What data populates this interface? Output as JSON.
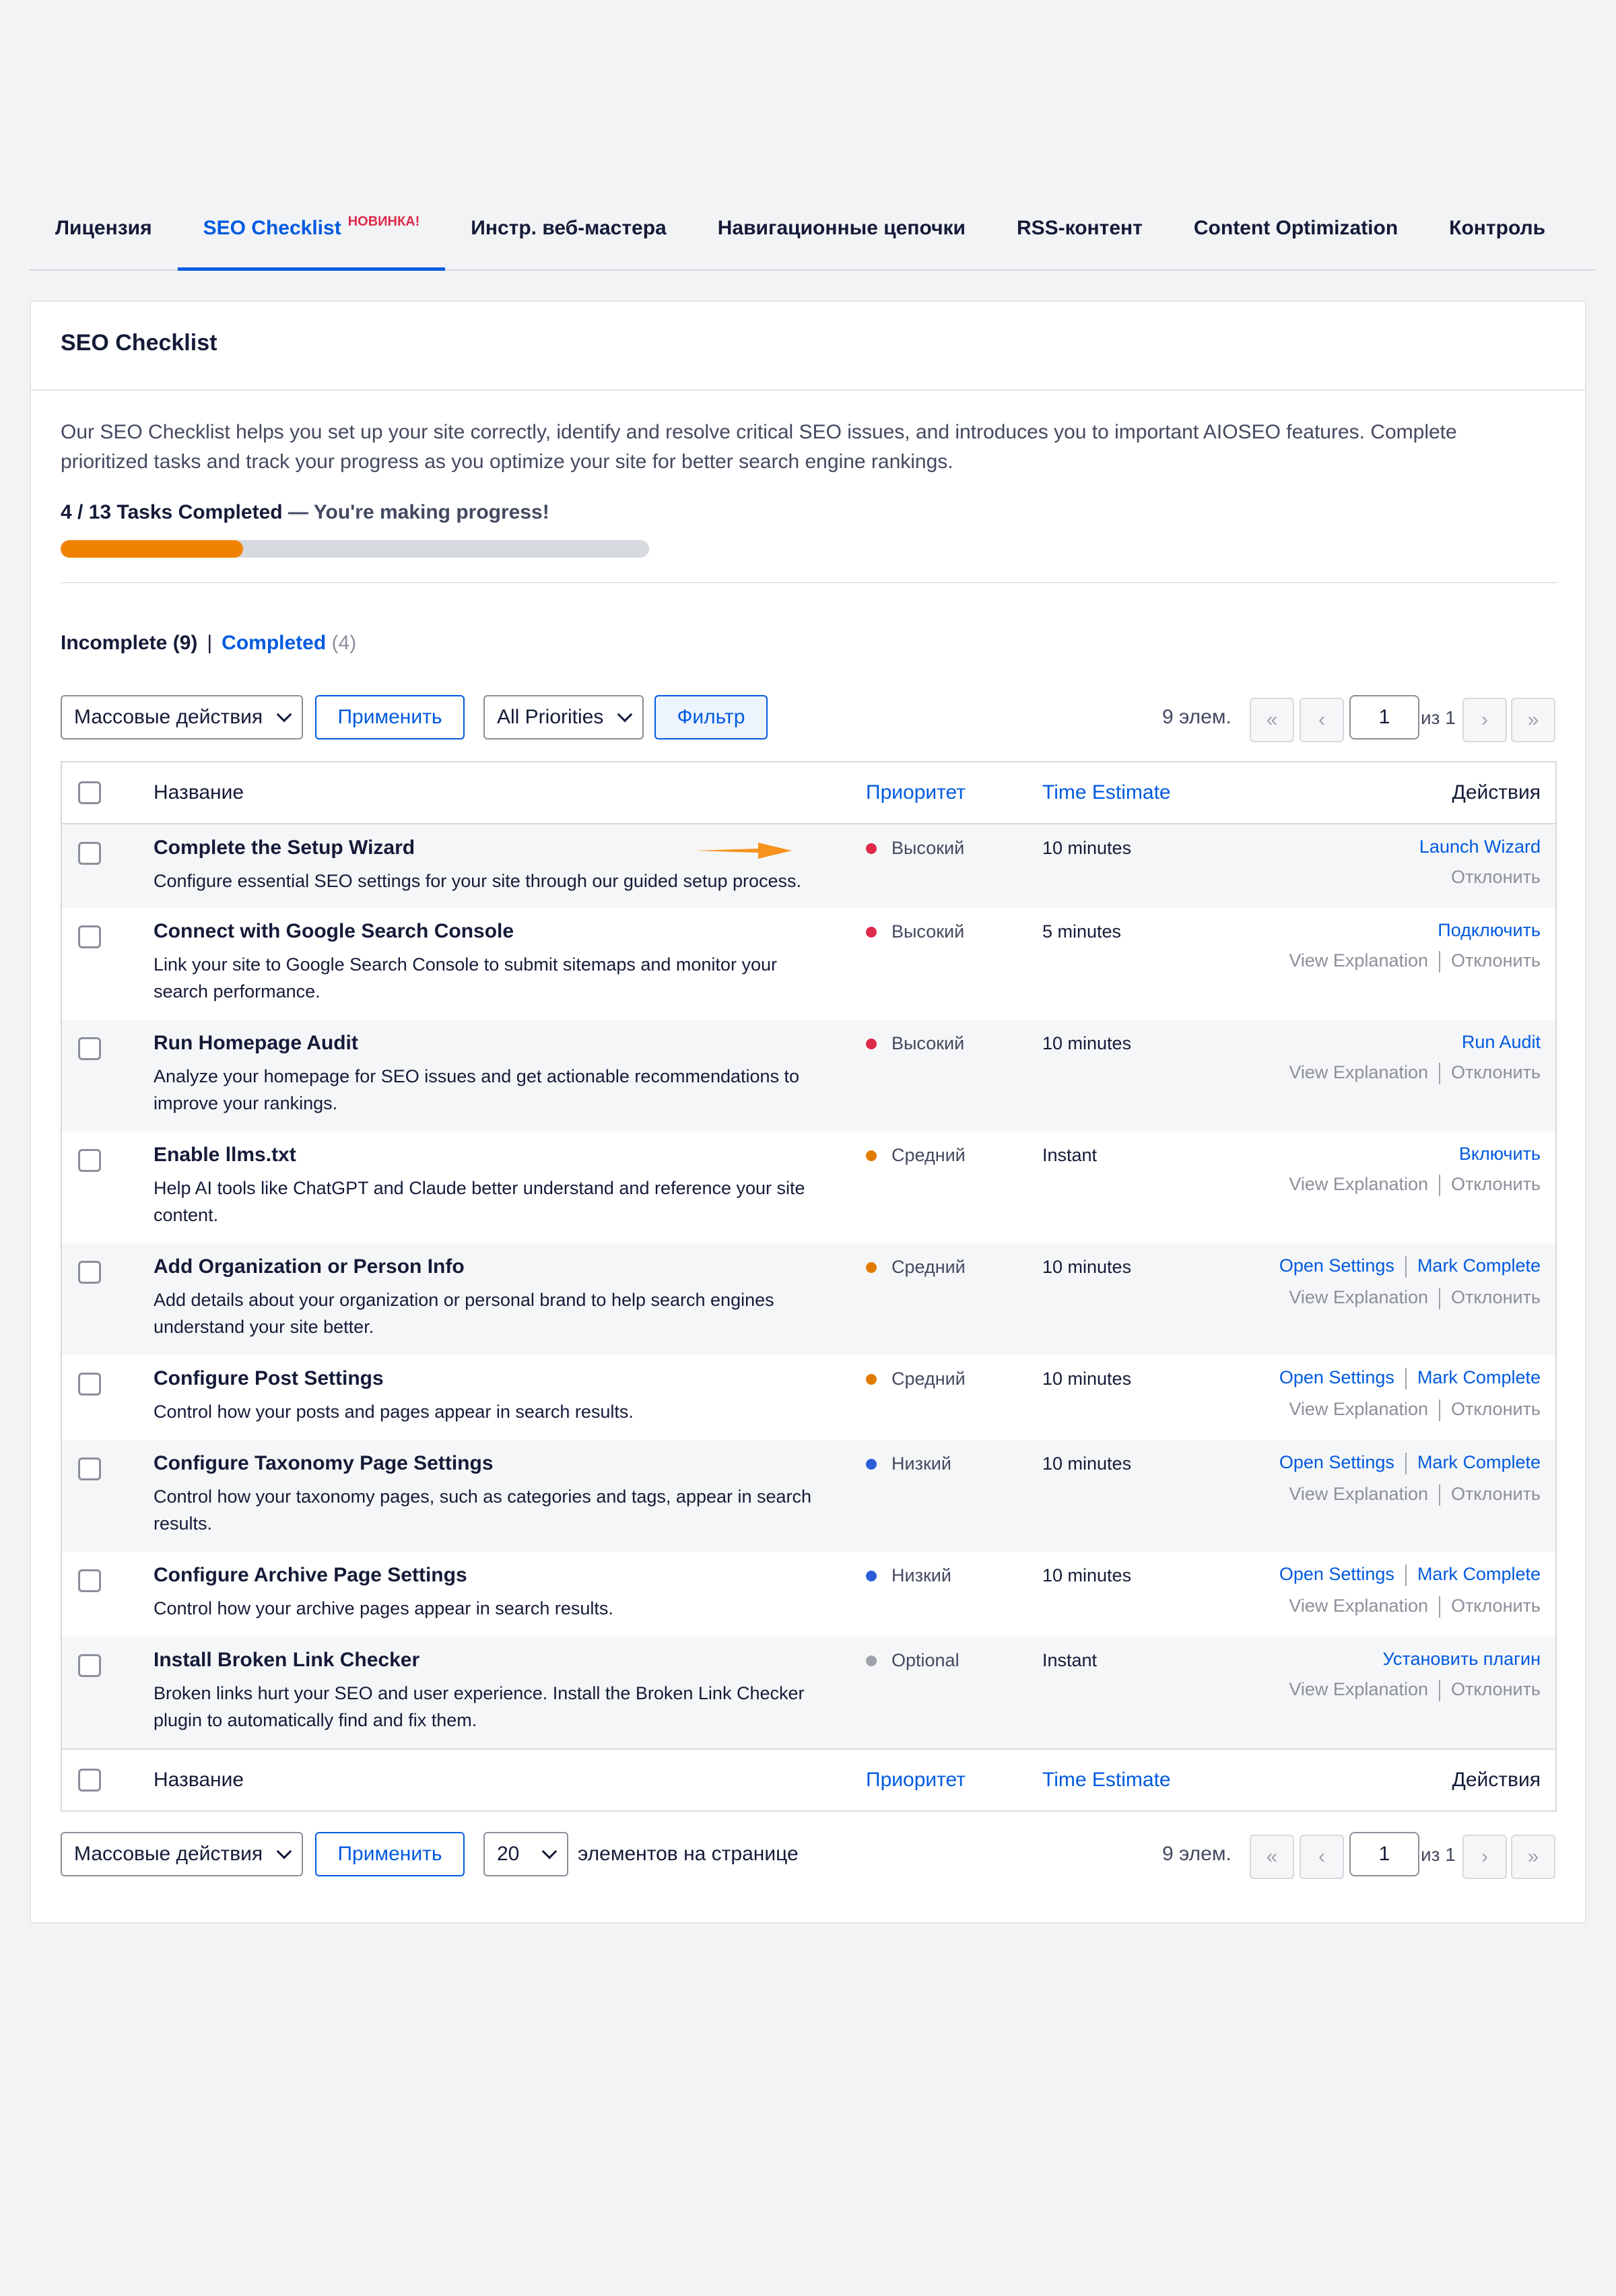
{
  "tabs": [
    {
      "label": "Лицензия",
      "active": false
    },
    {
      "label": "SEO Checklist",
      "badge": "НОВИНКА!",
      "active": true
    },
    {
      "label": "Инстр. веб-мастера",
      "active": false
    },
    {
      "label": "Навигационные цепочки",
      "active": false
    },
    {
      "label": "RSS-контент",
      "active": false
    },
    {
      "label": "Content Optimization",
      "active": false
    },
    {
      "label": "Контроль",
      "active": false
    }
  ],
  "card": {
    "title": "SEO Checklist",
    "intro": "Our SEO Checklist helps you set up your site correctly, identify and resolve critical SEO issues, and introduces you to important AIOSEO features. Complete prioritized tasks and track your progress as you optimize your site for better search engine rankings.",
    "progress_label": "4 / 13 Tasks Completed",
    "progress_message": " — You're making progress!",
    "progress_fraction": 0.31,
    "progress_color": "#f18200"
  },
  "filters": {
    "incomplete": "Incomplete (9)",
    "separator": "|",
    "completed": "Completed",
    "completed_count": "(4)"
  },
  "toolbar": {
    "bulk_actions": "Массовые действия",
    "apply": "Применить",
    "priorities": "All Priorities",
    "filter": "Фильтр",
    "items_count": "9 элем.",
    "first": "«",
    "prev": "‹",
    "page": "1",
    "of_pages": "из 1",
    "next": "›",
    "last": "»",
    "per_page_value": "20",
    "per_page_label": "элементов на странице"
  },
  "table": {
    "headers": {
      "name": "Название",
      "priority": "Приоритет",
      "time": "Time Estimate",
      "actions": "Действия"
    },
    "secondary_view": "View Explanation",
    "secondary_dismiss": "Отклонить",
    "priority_colors": {
      "Высокий": "#df2a4a",
      "Средний": "#e07b00",
      "Низкий": "#2b5fd9",
      "Optional": "#a0a3ab"
    },
    "rows": [
      {
        "title": "Complete the Setup Wizard",
        "desc": "Configure essential SEO settings for your site through our guided setup process.",
        "priority": "Высокий",
        "time": "10 minutes",
        "actions": [
          "Launch Wizard"
        ],
        "view": false
      },
      {
        "title": "Connect with Google Search Console",
        "desc": "Link your site to Google Search Console to submit sitemaps and monitor your search performance.",
        "priority": "Высокий",
        "time": "5 minutes",
        "actions": [
          "Подключить"
        ],
        "view": true
      },
      {
        "title": "Run Homepage Audit",
        "desc": "Analyze your homepage for SEO issues and get actionable recommendations to improve your rankings.",
        "priority": "Высокий",
        "time": "10 minutes",
        "actions": [
          "Run Audit"
        ],
        "view": true
      },
      {
        "title": "Enable llms.txt",
        "desc": "Help AI tools like ChatGPT and Claude better understand and reference your site content.",
        "priority": "Средний",
        "time": "Instant",
        "actions": [
          "Включить"
        ],
        "view": true
      },
      {
        "title": "Add Organization or Person Info",
        "desc": "Add details about your organization or personal brand to help search engines understand your site better.",
        "priority": "Средний",
        "time": "10 minutes",
        "actions": [
          "Open Settings",
          "Mark Complete"
        ],
        "view": true
      },
      {
        "title": "Configure Post Settings",
        "desc": "Control how your posts and pages appear in search results.",
        "priority": "Средний",
        "time": "10 minutes",
        "actions": [
          "Open Settings",
          "Mark Complete"
        ],
        "view": true
      },
      {
        "title": "Configure Taxonomy Page Settings",
        "desc": "Control how your taxonomy pages, such as categories and tags, appear in search results.",
        "priority": "Низкий",
        "time": "10 minutes",
        "actions": [
          "Open Settings",
          "Mark Complete"
        ],
        "view": true
      },
      {
        "title": "Configure Archive Page Settings",
        "desc": "Control how your archive pages appear in search results.",
        "priority": "Низкий",
        "time": "10 minutes",
        "actions": [
          "Open Settings",
          "Mark Complete"
        ],
        "view": true
      },
      {
        "title": "Install Broken Link Checker",
        "desc": "Broken links hurt your SEO and user experience. Install the Broken Link Checker plugin to automatically find and fix them.",
        "priority": "Optional",
        "time": "Instant",
        "actions": [
          "Установить плагин"
        ],
        "view": true
      }
    ]
  },
  "colors": {
    "accent": "#005ae0",
    "arrow": "#f7921e"
  }
}
